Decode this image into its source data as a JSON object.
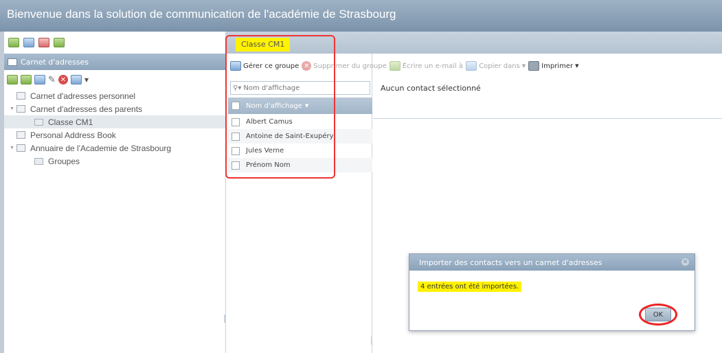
{
  "app": {
    "title": "Bienvenue dans la solution de communication de l'académie de Strasbourg"
  },
  "left_panel": {
    "header": "Carnet d'adresses",
    "tree": [
      {
        "label": "Carnet d'adresses personnel",
        "level": 0,
        "expanded": null,
        "selected": false,
        "kind": "book"
      },
      {
        "label": "Carnet d'adresses des parents",
        "level": 0,
        "expanded": true,
        "selected": false,
        "kind": "book"
      },
      {
        "label": "Classe CM1",
        "level": 1,
        "expanded": null,
        "selected": true,
        "kind": "group"
      },
      {
        "label": "Personal Address Book",
        "level": 0,
        "expanded": null,
        "selected": false,
        "kind": "book"
      },
      {
        "label": "Annuaire de l'Academie de Strasbourg",
        "level": 0,
        "expanded": true,
        "selected": false,
        "kind": "book"
      },
      {
        "label": "Groupes",
        "level": 1,
        "expanded": null,
        "selected": false,
        "kind": "group"
      }
    ]
  },
  "tab": {
    "label": "Classe CM1"
  },
  "actions": {
    "manage": "Gérer ce groupe",
    "remove": "Supprimer du groupe",
    "email": "Écrire un e-mail à",
    "copy": "Copier dans",
    "print": "Imprimer"
  },
  "contacts_list": {
    "search_placeholder": "Nom d'affichage",
    "column_header": "Nom d'affichage",
    "items": [
      "Albert Camus",
      "Antoine de Saint-Exupéry",
      "Jules Verne",
      "Prénom Nom"
    ]
  },
  "details": {
    "empty_text": "Aucun contact sélectionné"
  },
  "dialog": {
    "title": "Importer des contacts vers un carnet d'adresses",
    "message": "4 entrées ont été importées.",
    "ok_label": "OK"
  },
  "colors": {
    "highlight": "#fff200",
    "annotation": "#e33333",
    "header_blue": "#8ea5bc"
  }
}
